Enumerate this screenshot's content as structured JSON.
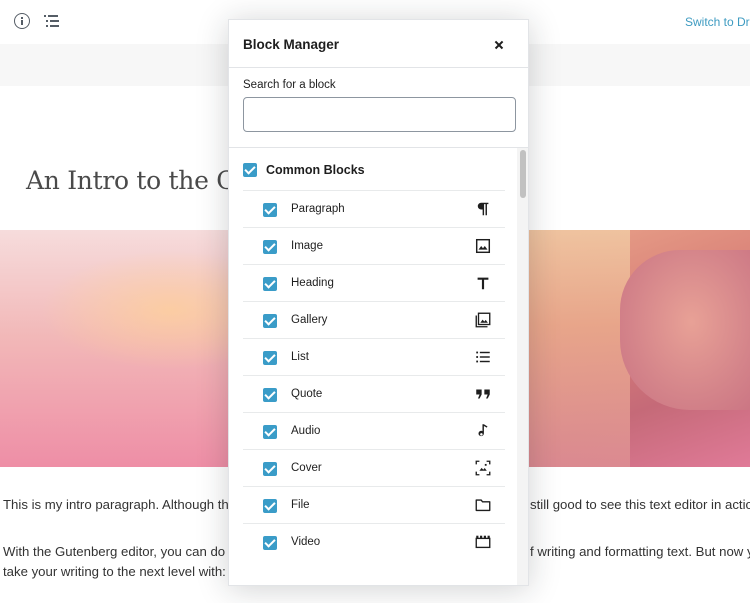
{
  "editor": {
    "switch_link": "Switch to Dra",
    "post_title": "An Intro to the Gu",
    "paragraph_1_left": "This is my intro paragraph. Although th",
    "paragraph_1_right": "still good to see this text editor in actio",
    "paragraph_2_left": "With the Gutenberg editor, you can do",
    "paragraph_2_right": "f writing and formatting text. But now y",
    "paragraph_3_left": "take your writing to the next level with:"
  },
  "modal": {
    "title": "Block Manager",
    "search_label": "Search for a block",
    "search_placeholder": "",
    "search_value": "",
    "category": {
      "label": "Common Blocks",
      "checked": true
    },
    "blocks": [
      {
        "label": "Paragraph",
        "icon": "paragraph-icon",
        "checked": true
      },
      {
        "label": "Image",
        "icon": "image-icon",
        "checked": true
      },
      {
        "label": "Heading",
        "icon": "heading-icon",
        "checked": true
      },
      {
        "label": "Gallery",
        "icon": "gallery-icon",
        "checked": true
      },
      {
        "label": "List",
        "icon": "list-icon",
        "checked": true
      },
      {
        "label": "Quote",
        "icon": "quote-icon",
        "checked": true
      },
      {
        "label": "Audio",
        "icon": "audio-icon",
        "checked": true
      },
      {
        "label": "Cover",
        "icon": "cover-icon",
        "checked": true
      },
      {
        "label": "File",
        "icon": "file-icon",
        "checked": true
      },
      {
        "label": "Video",
        "icon": "video-icon",
        "checked": true
      }
    ]
  },
  "colors": {
    "accent": "#3a9cc8",
    "link": "#3e9bc1"
  }
}
